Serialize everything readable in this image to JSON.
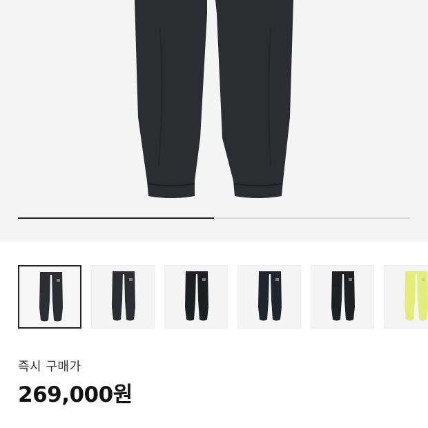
{
  "product": {
    "hero_image_icon": "sweatpants-image",
    "gallery_progress": 0.5,
    "thumbnails": [
      {
        "icon": "sweatpants-thumbnail",
        "color": "#2c2e33",
        "selected": true
      },
      {
        "icon": "sweatpants-thumbnail",
        "color": "#2b2d33",
        "selected": false
      },
      {
        "icon": "sweatpants-thumbnail",
        "color": "#1e1f22",
        "selected": false
      },
      {
        "icon": "sweatpants-thumbnail",
        "color": "#22252d",
        "selected": false
      },
      {
        "icon": "sweatpants-thumbnail",
        "color": "#1f2021",
        "selected": false
      },
      {
        "icon": "sweatpants-thumbnail",
        "color": "#e3ee7a",
        "selected": false
      }
    ]
  },
  "price": {
    "label": "즉시 구매가",
    "value": "269,000원"
  },
  "colors": {
    "hero_bg": "#f4f4f4",
    "pants": "#2b2d31",
    "progress_active": "#222222",
    "progress_track": "#d6d6d6"
  }
}
